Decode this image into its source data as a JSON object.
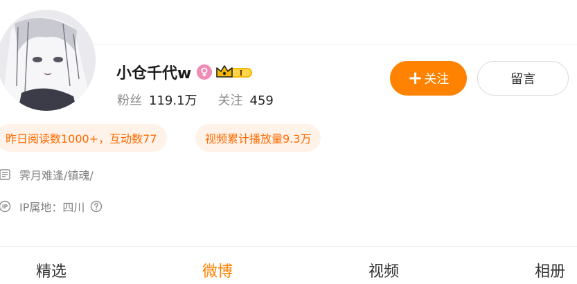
{
  "profile": {
    "username": "小仓千代w",
    "stats": {
      "followers_label": "粉丝",
      "followers_value": "119.1万",
      "following_label": "关注",
      "following_value": "459"
    },
    "badges": {
      "gender_icon": "female-icon",
      "vip_icon": "crown-vip-icon",
      "vip_level": "I"
    }
  },
  "actions": {
    "follow_label": "关注",
    "message_label": "留言"
  },
  "tags": {
    "reads": "昨日阅读数1000+，互动数77",
    "plays": "视频累计播放量9.3万"
  },
  "info": {
    "bio": "霁月难逢/镇魂/",
    "ip": "IP属地：四川"
  },
  "tabs": [
    {
      "label": "精选"
    },
    {
      "label": "微博"
    },
    {
      "label": "视频"
    },
    {
      "label": "相册"
    }
  ],
  "colors": {
    "accent": "#ff8200",
    "tag_bg": "#fff2e8",
    "tag_text": "#ff6a00",
    "female": "#f08bb5",
    "vip_gold": "#f5b800"
  }
}
